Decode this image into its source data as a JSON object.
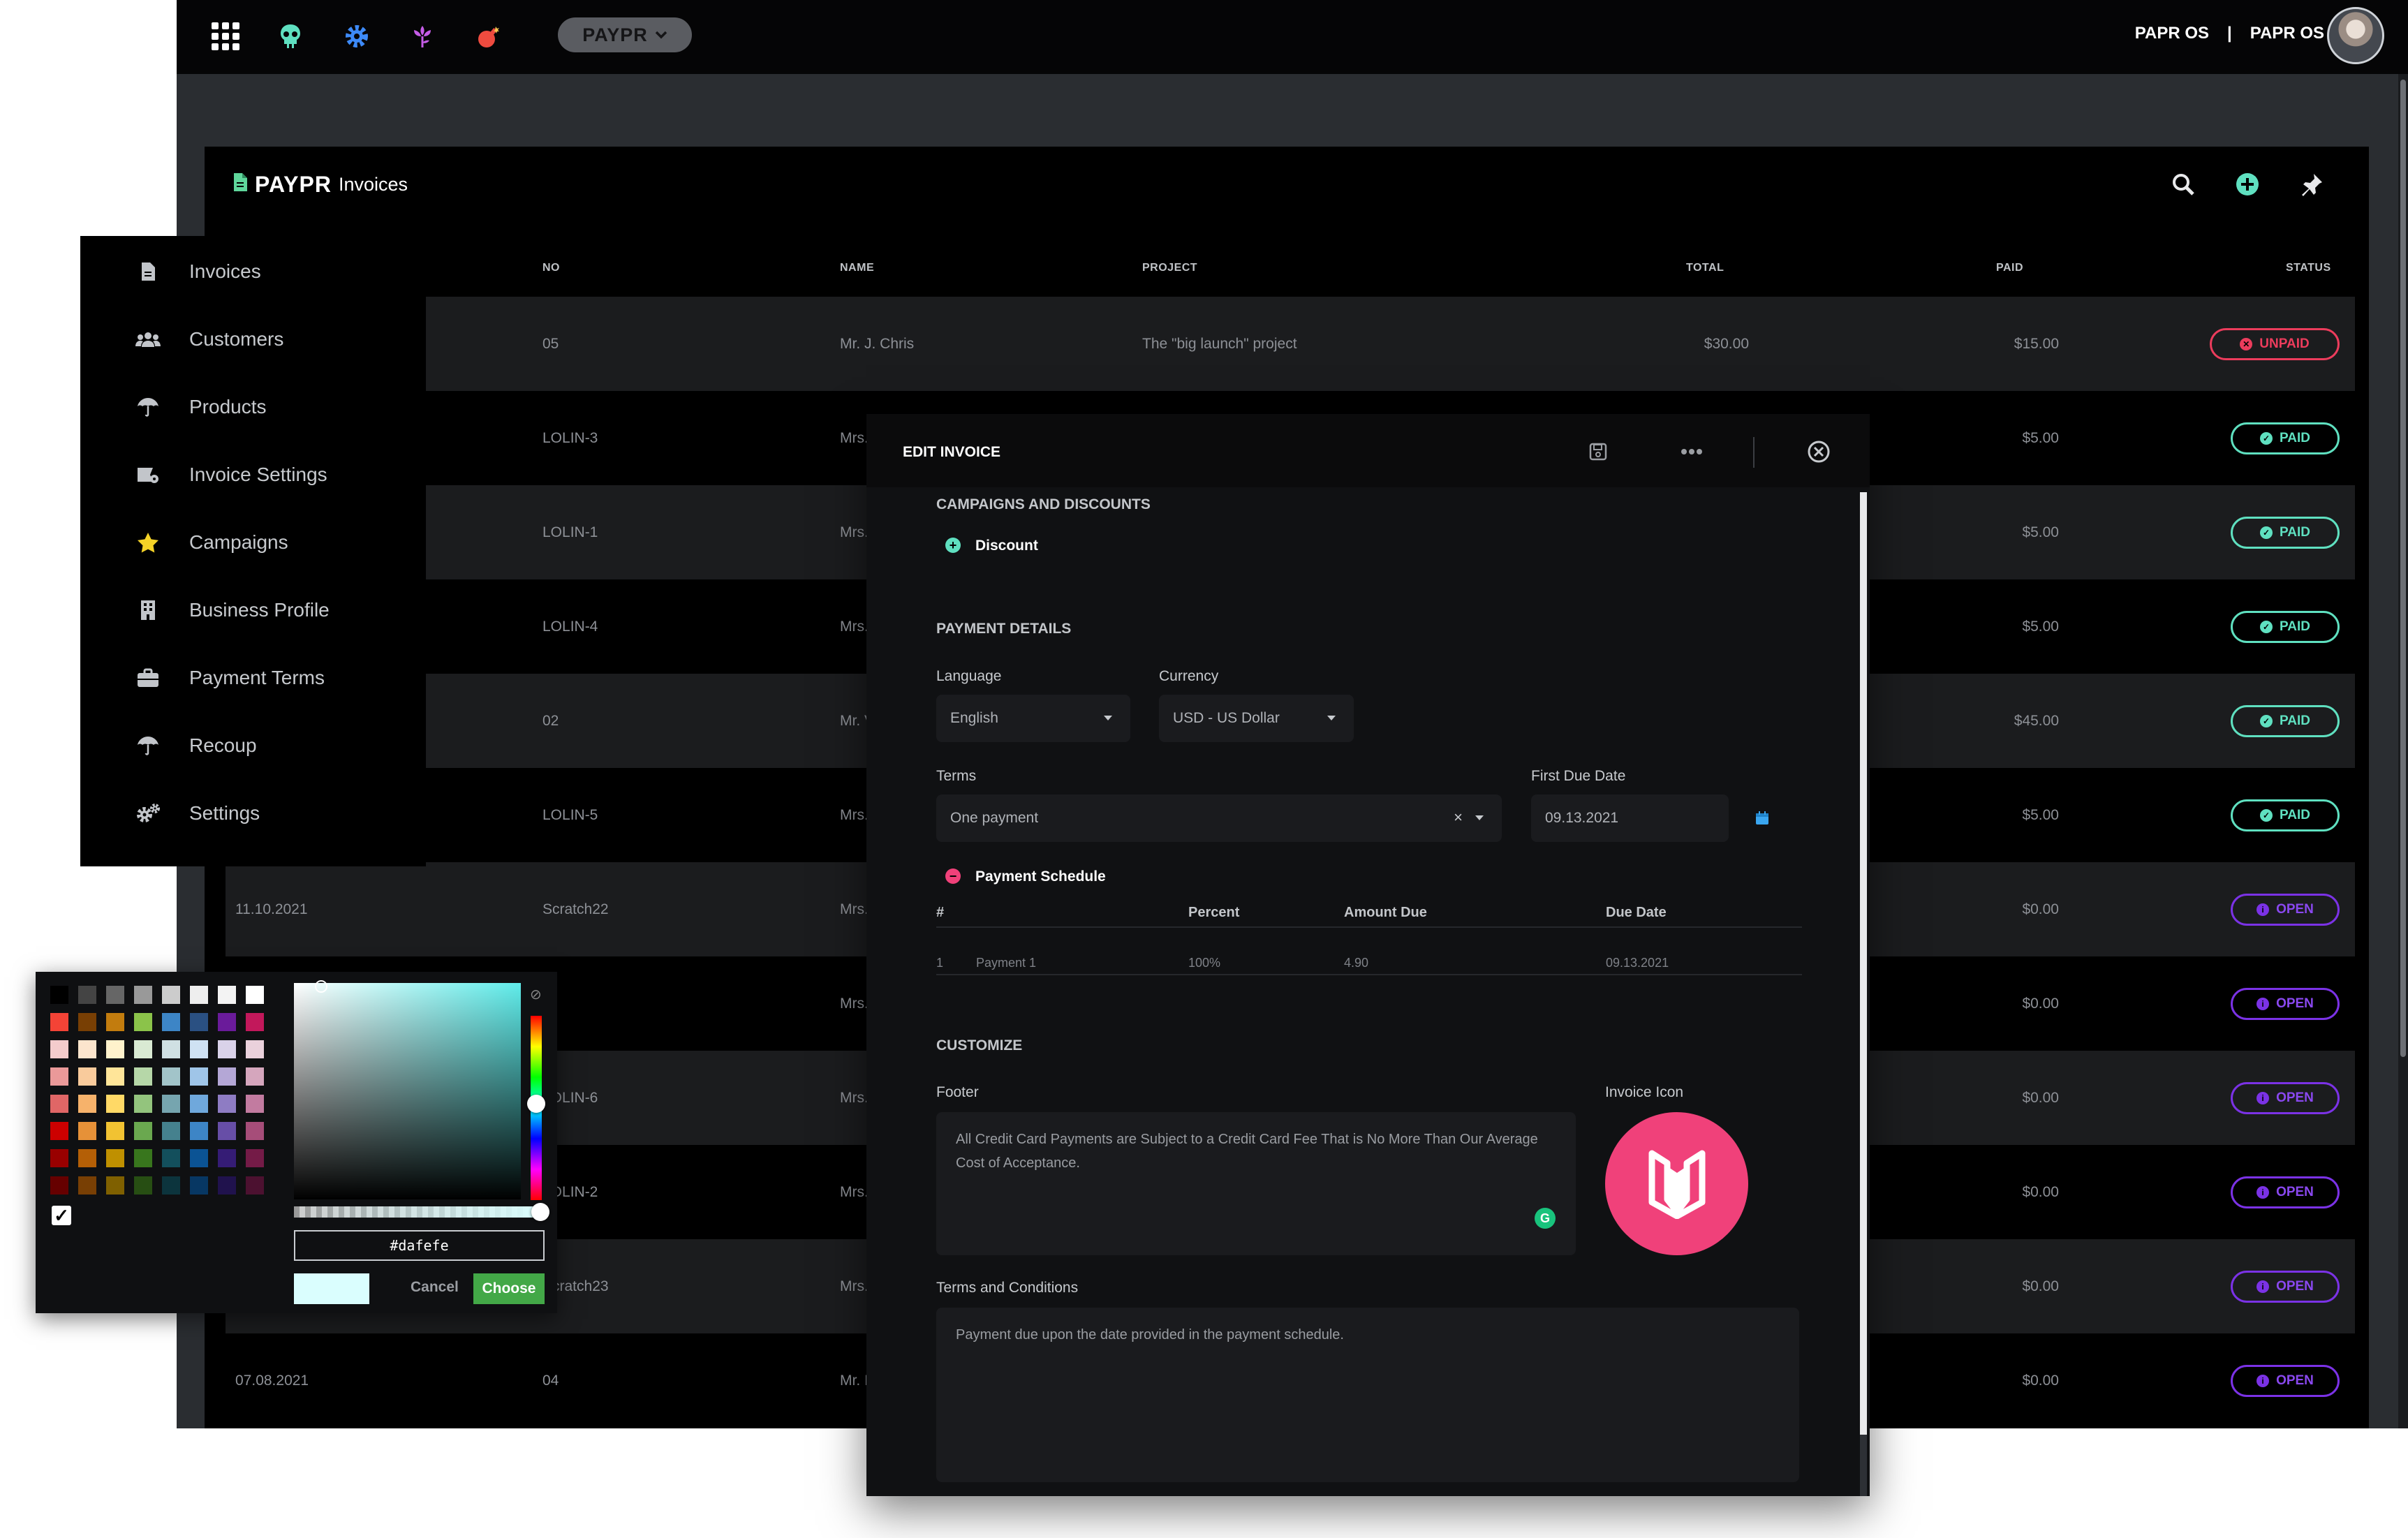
{
  "topbar": {
    "app_name": "PAYPR",
    "user": {
      "org": "PAPR OS",
      "separator": "|",
      "name": "PAPR OS"
    },
    "icons": [
      "apps-grid-icon",
      "skull-icon",
      "gear-icon",
      "flower-icon",
      "bomb-icon"
    ]
  },
  "page": {
    "brand_logo": "PAYPR",
    "title": "Invoices",
    "actions": [
      "search-icon",
      "add-icon",
      "pin-icon"
    ]
  },
  "table": {
    "columns": {
      "no": "NO",
      "name": "NAME",
      "project": "PROJECT",
      "total": "TOTAL",
      "paid": "PAID",
      "status": "STATUS"
    },
    "rows": [
      {
        "date": "",
        "no": "05",
        "name": "Mr. J. Chris",
        "project": "The \"big launch\" project",
        "total": "$30.00",
        "paid": "$15.00",
        "status": "UNPAID",
        "kind": "unpaid"
      },
      {
        "date": "",
        "no": "LOLIN-3",
        "name": "Mrs.",
        "project": "",
        "total": "",
        "paid": "$5.00",
        "status": "PAID",
        "kind": "paid"
      },
      {
        "date": "",
        "no": "LOLIN-1",
        "name": "Mrs.",
        "project": "",
        "total": "",
        "paid": "$5.00",
        "status": "PAID",
        "kind": "paid"
      },
      {
        "date": "",
        "no": "LOLIN-4",
        "name": "Mrs.",
        "project": "",
        "total": "",
        "paid": "$5.00",
        "status": "PAID",
        "kind": "paid"
      },
      {
        "date": "",
        "no": "02",
        "name": "Mr. V",
        "project": "",
        "total": "",
        "paid": "$45.00",
        "status": "PAID",
        "kind": "paid"
      },
      {
        "date": "",
        "no": "LOLIN-5",
        "name": "Mrs.",
        "project": "",
        "total": "",
        "paid": "$5.00",
        "status": "PAID",
        "kind": "paid"
      },
      {
        "date": "11.10.2021",
        "no": "Scratch22",
        "name": "Mrs.",
        "project": "",
        "total": "",
        "paid": "$0.00",
        "status": "OPEN",
        "kind": "open"
      },
      {
        "date": "",
        "no": "",
        "name": "Mrs.",
        "project": "",
        "total": "",
        "paid": "$0.00",
        "status": "OPEN",
        "kind": "open"
      },
      {
        "date": "",
        "no": "LOLIN-6",
        "name": "Mrs.",
        "project": "",
        "total": "",
        "paid": "$0.00",
        "status": "OPEN",
        "kind": "open"
      },
      {
        "date": "",
        "no": "LOLIN-2",
        "name": "Mrs.",
        "project": "",
        "total": "",
        "paid": "$0.00",
        "status": "OPEN",
        "kind": "open"
      },
      {
        "date": "",
        "no": "Scratch23",
        "name": "Mrs.",
        "project": "",
        "total": "",
        "paid": "$0.00",
        "status": "OPEN",
        "kind": "open"
      },
      {
        "date": "07.08.2021",
        "no": "04",
        "name": "Mr. I",
        "project": "",
        "total": "",
        "paid": "$0.00",
        "status": "OPEN",
        "kind": "open"
      }
    ]
  },
  "sidebar": {
    "items": [
      {
        "label": "Invoices",
        "icon": "file-invoice-icon"
      },
      {
        "label": "Customers",
        "icon": "users-icon"
      },
      {
        "label": "Products",
        "icon": "umbrella-icon"
      },
      {
        "label": "Invoice Settings",
        "icon": "invoice-settings-icon"
      },
      {
        "label": "Campaigns",
        "icon": "star-icon"
      },
      {
        "label": "Business Profile",
        "icon": "building-icon"
      },
      {
        "label": "Payment Terms",
        "icon": "briefcase-icon"
      },
      {
        "label": "Recoup",
        "icon": "umbrella-icon"
      },
      {
        "label": "Settings",
        "icon": "cogs-icon"
      }
    ]
  },
  "color_picker": {
    "hex_value": "#dafefe",
    "cancel_label": "Cancel",
    "choose_label": "Choose",
    "preview_color": "#dafefe",
    "palette": [
      [
        "#000000",
        "#444444",
        "#666666",
        "#999999",
        "#cccccc",
        "#eeeeee",
        "#f3f3f3",
        "#ffffff"
      ],
      [
        "#f44336",
        "#783f04",
        "#c27c0e",
        "#8bc34a",
        "#3d85c6",
        "#2a5082",
        "#6a1b9a",
        "#c2185b"
      ],
      [
        "#f4cccc",
        "#fce5cd",
        "#fff2cc",
        "#d9ead3",
        "#d0e0e3",
        "#cfe2f3",
        "#d9d2e9",
        "#ead1dc"
      ],
      [
        "#ea9999",
        "#f9cb9c",
        "#ffe599",
        "#b6d7a8",
        "#a2c4c9",
        "#9fc5e8",
        "#b4a7d6",
        "#d5a6bd"
      ],
      [
        "#e06666",
        "#f6b26b",
        "#ffd966",
        "#93c47d",
        "#76a5af",
        "#6fa8dc",
        "#8e7cc3",
        "#c27ba0"
      ],
      [
        "#cc0000",
        "#e69138",
        "#f1c232",
        "#6aa84f",
        "#45818e",
        "#3d85c6",
        "#674ea7",
        "#a64d79"
      ],
      [
        "#990000",
        "#b45f06",
        "#bf9000",
        "#38761d",
        "#134f5c",
        "#0b5394",
        "#351c75",
        "#741b47"
      ],
      [
        "#660000",
        "#783f04",
        "#7f6000",
        "#274e13",
        "#0c343d",
        "#073763",
        "#20124d",
        "#4c1130"
      ]
    ]
  },
  "modal": {
    "title": "EDIT INVOICE",
    "campaigns": {
      "heading": "CAMPAIGNS AND DISCOUNTS",
      "discount_label": "Discount"
    },
    "payment": {
      "heading": "PAYMENT DETAILS",
      "language_label": "Language",
      "language_value": "English",
      "currency_label": "Currency",
      "currency_value": "USD - US Dollar",
      "terms_label": "Terms",
      "terms_value": "One payment",
      "terms_clear": "×",
      "due_label": "First Due Date",
      "due_value": "09.13.2021"
    },
    "schedule": {
      "label": "Payment Schedule",
      "headers": {
        "num": "#",
        "percent": "Percent",
        "amount": "Amount Due",
        "date": "Due Date"
      },
      "rows": [
        {
          "num": "1",
          "name": "Payment 1",
          "percent": "100%",
          "amount": "4.90",
          "date": "09.13.2021"
        }
      ]
    },
    "customize": {
      "heading": "CUSTOMIZE",
      "footer_label": "Footer",
      "footer_value": "All Credit Card Payments are Subject to a Credit Card Fee That is No More Than Our Average Cost of Acceptance.",
      "icon_label": "Invoice Icon",
      "terms_label": "Terms and Conditions",
      "terms_value": "Payment due upon the date provided in the payment schedule."
    }
  },
  "colors": {
    "accent_green": "#5fe0c0",
    "unpaid_red": "#ec3c5c",
    "open_purple": "#7b32e6",
    "icon_pink": "#f0417a",
    "choose_green": "#43a847"
  }
}
